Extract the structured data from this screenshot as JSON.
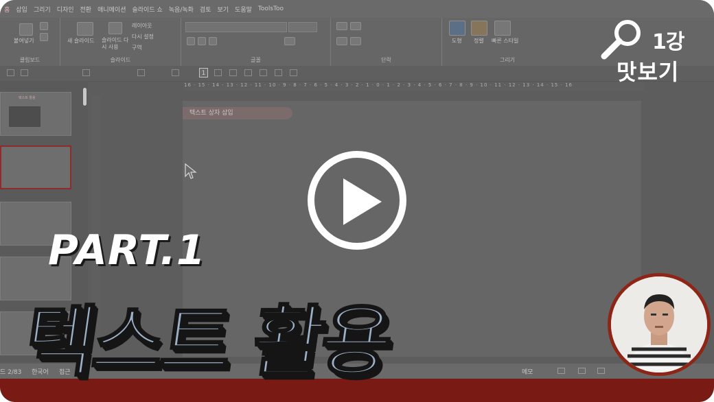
{
  "ppt": {
    "menu": [
      "홈",
      "삽입",
      "그리기",
      "디자인",
      "전환",
      "애니메이션",
      "슬라이드 쇼",
      "녹음/녹화",
      "검토",
      "보기",
      "도움말",
      "ToolsToo"
    ],
    "ribbon_groups": [
      {
        "label": "클립보드"
      },
      {
        "label": "슬라이드"
      },
      {
        "label": "글꼴"
      },
      {
        "label": "단락"
      },
      {
        "label": "그리기"
      }
    ],
    "slide_buttons": {
      "new_slide": "새 슬라이드",
      "reuse": "슬라이드 다시 사용",
      "layout": "레이아웃",
      "reset": "다시 설정",
      "section": "구역"
    },
    "clipboard_buttons": {
      "paste": "붙여넣기"
    },
    "draw_buttons": {
      "shape": "도형",
      "arrange": "정렬",
      "quick_style": "빠른 스타일"
    },
    "qat_page_box": "1",
    "ruler_text": "16 · 15 · 14 · 13 · 12 · 11 · 10 · 9 · 8 · 7 · 6 · 5 · 4 · 3 · 2 · 1 · 0 · 1 · 2 · 3 · 4 · 5 · 6 · 7 · 8 · 9 · 10 · 11 · 12 · 13 · 14 · 15 · 16",
    "textbox_label": "텍스트 상자 삽입",
    "thumb_title": "텍스트 활용",
    "status": {
      "slide_count": "드 2/83",
      "language": "한국어",
      "accessibility": "접근",
      "notes": "메모"
    }
  },
  "overlay": {
    "badge_number": "1강",
    "badge_text": "맛보기",
    "part_label": "PART.1",
    "title": "텍스트 활용"
  },
  "colors": {
    "accent_red": "#7a1a14",
    "title_fill": "#9cb0c7",
    "ring": "#8e2617"
  },
  "icons": [
    "magnifier-icon",
    "play-icon",
    "mouse-cursor-icon"
  ]
}
